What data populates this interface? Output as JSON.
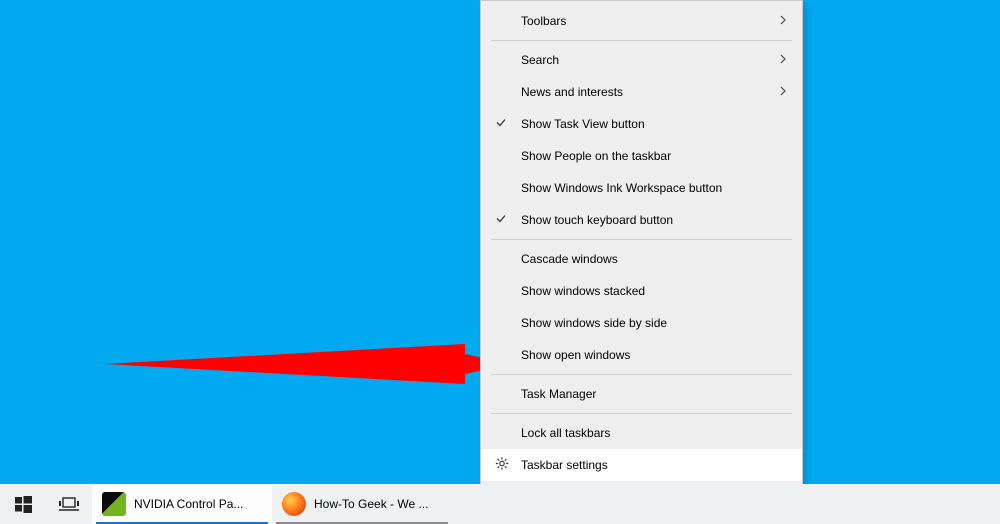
{
  "menu": {
    "toolbars": "Toolbars",
    "search": "Search",
    "news": "News and interests",
    "show_task_view": "Show Task View button",
    "show_people": "Show People on the taskbar",
    "show_ink": "Show Windows Ink Workspace button",
    "show_touch": "Show touch keyboard button",
    "cascade": "Cascade windows",
    "stacked": "Show windows stacked",
    "side": "Show windows side by side",
    "open": "Show open windows",
    "task_manager": "Task Manager",
    "lock": "Lock all taskbars",
    "settings": "Taskbar settings"
  },
  "taskbar": {
    "app1": "NVIDIA Control Pa...",
    "app2": "How-To Geek - We ..."
  }
}
